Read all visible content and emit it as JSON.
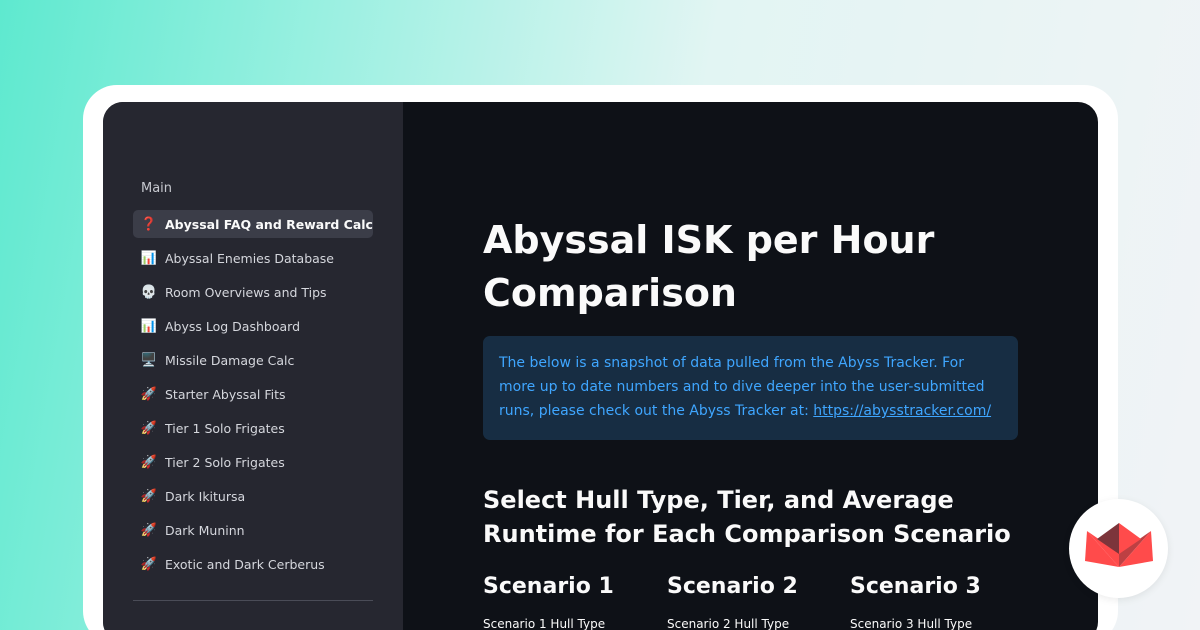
{
  "sidebar": {
    "heading": "Main",
    "items": [
      {
        "icon": "❓",
        "icon_name": "question-mark-icon",
        "label": "Abyssal FAQ and Reward Calc",
        "active": true
      },
      {
        "icon": "📊",
        "icon_name": "bar-chart-icon",
        "label": "Abyssal Enemies Database"
      },
      {
        "icon": "💀",
        "icon_name": "skull-icon",
        "label": "Room Overviews and Tips"
      },
      {
        "icon": "📊",
        "icon_name": "bar-chart-icon",
        "label": "Abyss Log Dashboard"
      },
      {
        "icon": "🖥️",
        "icon_name": "computer-icon",
        "label": "Missile Damage Calc"
      },
      {
        "icon": "🚀",
        "icon_name": "rocket-icon",
        "label": "Starter Abyssal Fits"
      },
      {
        "icon": "🚀",
        "icon_name": "rocket-icon",
        "label": "Tier 1 Solo Frigates"
      },
      {
        "icon": "🚀",
        "icon_name": "rocket-icon",
        "label": "Tier 2 Solo Frigates"
      },
      {
        "icon": "🚀",
        "icon_name": "rocket-icon",
        "label": "Dark Ikitursa"
      },
      {
        "icon": "🚀",
        "icon_name": "rocket-icon",
        "label": "Dark Muninn"
      },
      {
        "icon": "🚀",
        "icon_name": "rocket-icon",
        "label": "Exotic and Dark Cerberus"
      }
    ]
  },
  "main": {
    "title": "Abyssal ISK per Hour Comparison",
    "info": {
      "text": "The below is a snapshot of data pulled from the Abyss Tracker. For more up to date numbers and to dive deeper into the user-submitted runs, please check out the Abyss Tracker at: ",
      "link_text": "https://abysstracker.com/"
    },
    "section_title": "Select Hull Type, Tier, and Average Runtime for Each Comparison Scenario",
    "scenarios": [
      {
        "title": "Scenario 1",
        "label": "Scenario 1 Hull Type"
      },
      {
        "title": "Scenario 2",
        "label": "Scenario 2 Hull Type"
      },
      {
        "title": "Scenario 3",
        "label": "Scenario 3 Hull Type"
      }
    ]
  },
  "colors": {
    "sidebar_bg": "#262730",
    "main_bg": "#0e1117",
    "info_bg": "#172d43",
    "info_text": "#3fa6ff",
    "logo_red": "#ff4b4b"
  },
  "logo": {
    "icon_name": "streamlit-crown-icon"
  }
}
